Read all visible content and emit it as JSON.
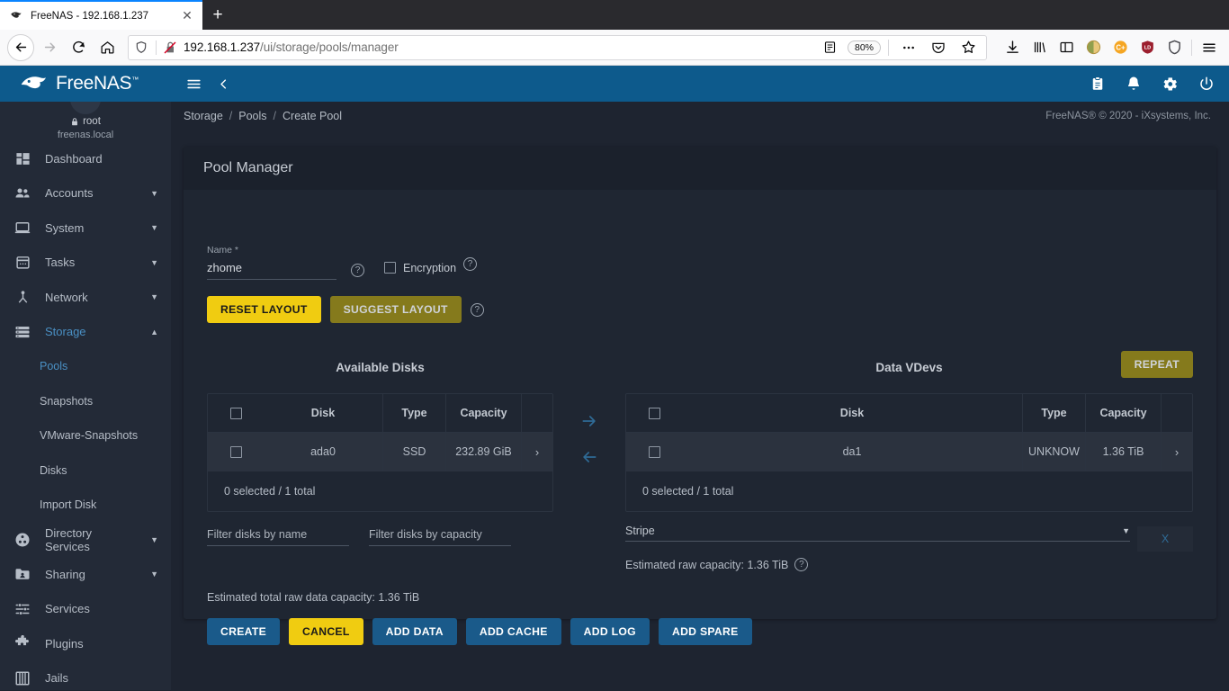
{
  "browser": {
    "tab": {
      "title": "FreeNAS - 192.168.1.237",
      "favicon": "freenas-favicon",
      "close_label": "✕"
    },
    "newtab_label": "+",
    "url": {
      "host": "192.168.1.237",
      "path": "/ui/storage/pools/manager"
    },
    "zoom_level": "80%",
    "nav": {
      "back": "back-arrow",
      "forward": "forward-arrow",
      "reload": "reload",
      "home": "home"
    },
    "toolbar_icons": [
      "downloads",
      "library",
      "sidebars",
      "profile",
      "coinbase-extension",
      "lastpass-extension",
      "shield-extension",
      "menu"
    ]
  },
  "app": {
    "logo": "FreeNAS",
    "logo_tm": "™",
    "header_icons": [
      "clipboard",
      "bell",
      "gear",
      "power"
    ],
    "user": {
      "name": "root",
      "host": "freenas.local"
    },
    "copyright": "FreeNAS® © 2020 - iXsystems, Inc."
  },
  "breadcrumb": {
    "items": [
      "Storage",
      "Pools",
      "Create Pool"
    ],
    "separator": "/"
  },
  "sidebar": {
    "items": [
      {
        "label": "Dashboard",
        "icon": "dashboard-icon",
        "expandable": false,
        "active": false,
        "sub": false
      },
      {
        "label": "Accounts",
        "icon": "accounts-icon",
        "expandable": true,
        "active": false,
        "sub": false
      },
      {
        "label": "System",
        "icon": "system-icon",
        "expandable": true,
        "active": false,
        "sub": false
      },
      {
        "label": "Tasks",
        "icon": "tasks-icon",
        "expandable": true,
        "active": false,
        "sub": false
      },
      {
        "label": "Network",
        "icon": "network-icon",
        "expandable": true,
        "active": false,
        "sub": false
      },
      {
        "label": "Storage",
        "icon": "storage-icon",
        "expandable": true,
        "active": true,
        "sub": false
      },
      {
        "label": "Pools",
        "icon": "",
        "expandable": false,
        "active": true,
        "sub": true
      },
      {
        "label": "Snapshots",
        "icon": "",
        "expandable": false,
        "active": false,
        "sub": true
      },
      {
        "label": "VMware-Snapshots",
        "icon": "",
        "expandable": false,
        "active": false,
        "sub": true
      },
      {
        "label": "Disks",
        "icon": "",
        "expandable": false,
        "active": false,
        "sub": true
      },
      {
        "label": "Import Disk",
        "icon": "",
        "expandable": false,
        "active": false,
        "sub": true
      },
      {
        "label": "Directory Services",
        "icon": "directory-services-icon",
        "expandable": true,
        "active": false,
        "sub": false
      },
      {
        "label": "Sharing",
        "icon": "sharing-icon",
        "expandable": true,
        "active": false,
        "sub": false
      },
      {
        "label": "Services",
        "icon": "services-icon",
        "expandable": false,
        "active": false,
        "sub": false
      },
      {
        "label": "Plugins",
        "icon": "plugins-icon",
        "expandable": false,
        "active": false,
        "sub": false
      },
      {
        "label": "Jails",
        "icon": "jails-icon",
        "expandable": false,
        "active": false,
        "sub": false
      }
    ]
  },
  "pool_manager": {
    "card_title": "Pool Manager",
    "name_field": {
      "label": "Name *",
      "value": "zhome"
    },
    "encryption": {
      "label": "Encryption",
      "checked": false
    },
    "reset_layout_label": "RESET LAYOUT",
    "suggest_layout_label": "SUGGEST LAYOUT",
    "available_disks": {
      "title": "Available Disks",
      "columns": [
        "Disk",
        "Type",
        "Capacity"
      ],
      "rows": [
        {
          "disk": "ada0",
          "type": "SSD",
          "capacity": "232.89 GiB",
          "selected": false
        }
      ],
      "footer": "0 selected / 1 total",
      "expand_chevron": "›"
    },
    "data_vdevs": {
      "title": "Data VDevs",
      "repeat_label": "REPEAT",
      "columns": [
        "Disk",
        "Type",
        "Capacity"
      ],
      "rows": [
        {
          "disk": "da1",
          "type": "UNKNOW",
          "capacity": "1.36 TiB",
          "selected": false
        }
      ],
      "footer": "0 selected / 1 total",
      "expand_chevron": "›",
      "vdev_type": "Stripe",
      "remove_label": "X",
      "raw_capacity": "Estimated raw capacity: 1.36 TiB"
    },
    "filters": {
      "by_name_placeholder": "Filter disks by name",
      "by_name_value": "",
      "by_capacity_placeholder": "Filter disks by capacity",
      "by_capacity_value": ""
    },
    "transfer": {
      "to_vdev": "→",
      "to_available": "←"
    },
    "total_capacity": "Estimated total raw data capacity: 1.36 TiB",
    "actions": [
      {
        "label": "CREATE",
        "style": "blue"
      },
      {
        "label": "CANCEL",
        "style": "yellow"
      },
      {
        "label": "ADD DATA",
        "style": "blue"
      },
      {
        "label": "ADD CACHE",
        "style": "blue"
      },
      {
        "label": "ADD LOG",
        "style": "blue"
      },
      {
        "label": "ADD SPARE",
        "style": "blue"
      }
    ]
  },
  "colors": {
    "brand_blue": "#0d5a8c",
    "accent_yellow": "#f0cc11",
    "olive": "#857a1c",
    "button_blue": "#1a5a8a",
    "bg_dark": "#1e2430",
    "sidebar_bg": "#232a37",
    "row_highlight": "#2b323e",
    "link_blue": "#4a90c4"
  }
}
